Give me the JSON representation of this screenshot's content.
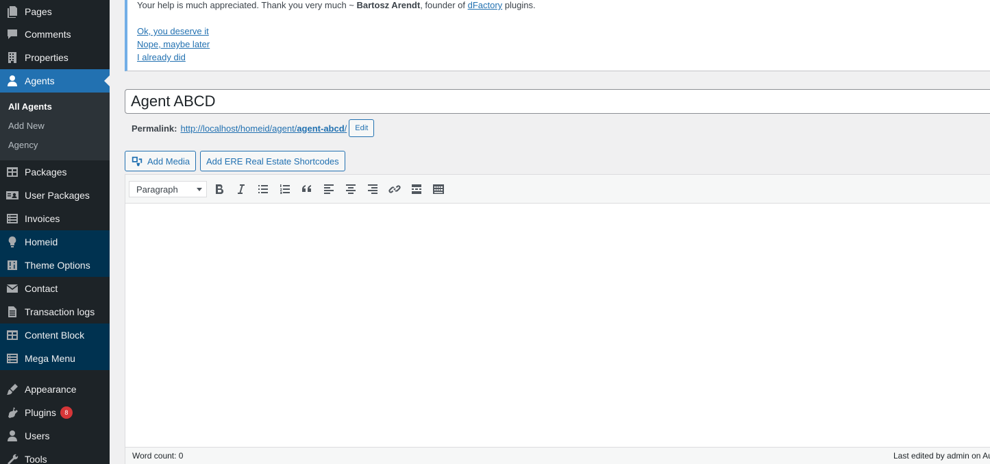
{
  "sidebar": {
    "items": [
      {
        "label": "Pages",
        "icon": "pages-icon"
      },
      {
        "label": "Comments",
        "icon": "comments-icon"
      },
      {
        "label": "Properties",
        "icon": "building-icon"
      },
      {
        "label": "Agents",
        "icon": "user-icon"
      },
      {
        "label": "Packages",
        "icon": "table-icon"
      },
      {
        "label": "User Packages",
        "icon": "id-card-icon"
      },
      {
        "label": "Invoices",
        "icon": "list-icon"
      },
      {
        "label": "Homeid",
        "icon": "lightbulb-icon"
      },
      {
        "label": "Theme Options",
        "icon": "sliders-icon"
      },
      {
        "label": "Contact",
        "icon": "mail-icon"
      },
      {
        "label": "Transaction logs",
        "icon": "document-icon"
      },
      {
        "label": "Content Block",
        "icon": "table-icon"
      },
      {
        "label": "Mega Menu",
        "icon": "list-icon"
      },
      {
        "label": "Appearance",
        "icon": "paintbrush-icon"
      },
      {
        "label": "Plugins",
        "icon": "plugin-icon",
        "badge": "8"
      },
      {
        "label": "Users",
        "icon": "user-icon"
      },
      {
        "label": "Tools",
        "icon": "wrench-icon"
      }
    ],
    "submenu": [
      "All Agents",
      "Add New",
      "Agency"
    ],
    "active_item": "Agents",
    "current_sub": "All Agents",
    "colors": {
      "bg": "#1d2327",
      "active": "#2271b1",
      "theme_bg": "#003250",
      "badge": "#d63638"
    }
  },
  "notice": {
    "msg_prefix": "Your help is much appreciated. Thank you very much ~ ",
    "author": "Bartosz Arendt",
    "msg_middle": ", founder of ",
    "company_link": "dFactory",
    "msg_suffix": " plugins.",
    "links": [
      "Ok, you deserve it",
      "Nope, maybe later",
      "I already did"
    ]
  },
  "post": {
    "title": "Agent ABCD",
    "permalink_label": "Permalink:",
    "permalink_base": "http://localhost/homeid/agent/",
    "permalink_slug": "agent-abcd",
    "permalink_trail": "/",
    "edit_label": "Edit"
  },
  "media_buttons": {
    "add_media": "Add Media",
    "shortcodes": "Add ERE Real Estate Shortcodes"
  },
  "editor": {
    "format": "Paragraph",
    "toolbar_icons": [
      "bold-icon",
      "italic-icon",
      "bulleted-list-icon",
      "numbered-list-icon",
      "blockquote-icon",
      "align-left-icon",
      "align-center-icon",
      "align-right-icon",
      "link-icon",
      "read-more-icon",
      "toolbar-toggle-icon"
    ],
    "word_count": "Word count: 0",
    "last_edited": "Last edited by admin on Au"
  }
}
